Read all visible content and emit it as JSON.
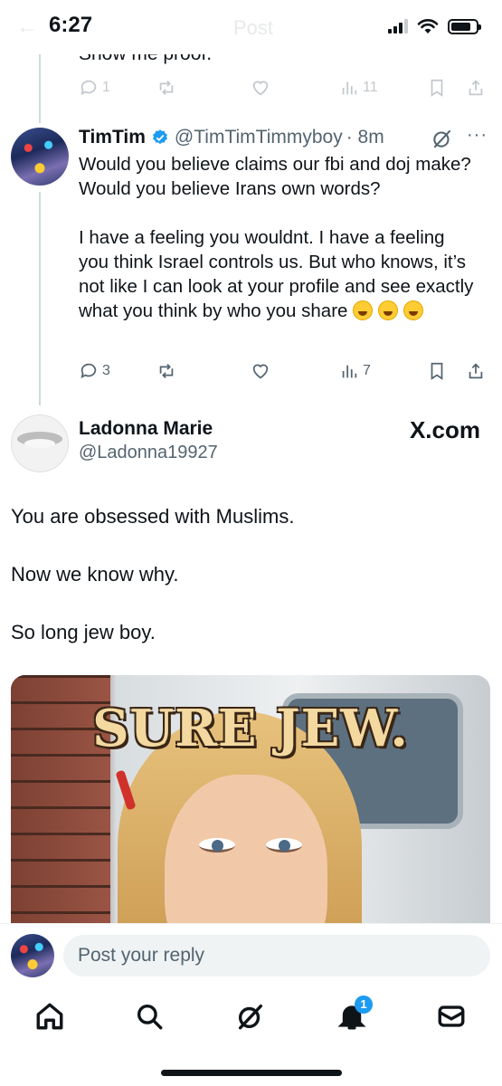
{
  "status_bar": {
    "time": "6:27",
    "ghost_title": "Post"
  },
  "previous_tweet": {
    "partial_text": "Show me proof.",
    "stats": {
      "replies": "1",
      "views": "11"
    }
  },
  "reply_tweet": {
    "name": "TimTim",
    "handle": "@TimTimTimmyboy",
    "time": "· 8m",
    "paragraph_1": "Would you believe claims our fbi and doj make?  Would you believe Irans own words?",
    "paragraph_2": "I have a feeling you wouldnt.  I have a feeling you think Israel controls us.  But who knows, it’s not like I can look at your profile and see exactly what you think by who you share",
    "stats": {
      "replies": "3",
      "views": "7"
    }
  },
  "screenshot_post": {
    "name": "Ladonna Marie",
    "handle": "@Ladonna19927",
    "watermark": "X.com",
    "lines": [
      "You are obsessed with Muslims.",
      "Now we know why.",
      "So long jew boy."
    ],
    "image_caption": "SURE JEW."
  },
  "reply_bar": {
    "placeholder": "Post your reply"
  },
  "bottom_nav": {
    "items": [
      "home-icon",
      "search-icon",
      "grok-icon",
      "notifications-icon",
      "messages-icon"
    ],
    "notification_count": "1"
  },
  "colors": {
    "accent": "#1d9bf0",
    "text": "#0f1419",
    "muted": "#536471"
  }
}
